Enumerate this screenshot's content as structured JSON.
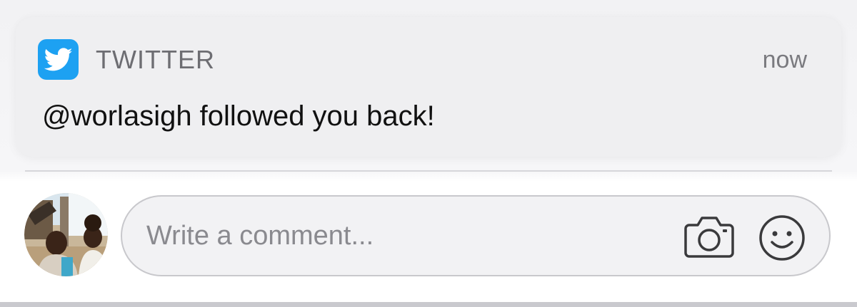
{
  "notification": {
    "app_icon": "twitter-bird-icon",
    "app_name": "TWITTER",
    "time": "now",
    "message": "@worlasigh followed you back!",
    "accent": "#1da1f2"
  },
  "comment": {
    "placeholder": "Write a comment...",
    "value": "",
    "camera_icon": "camera-icon",
    "emoji_icon": "smiley-icon"
  },
  "avatar": {
    "icon": "user-photo-avatar"
  }
}
